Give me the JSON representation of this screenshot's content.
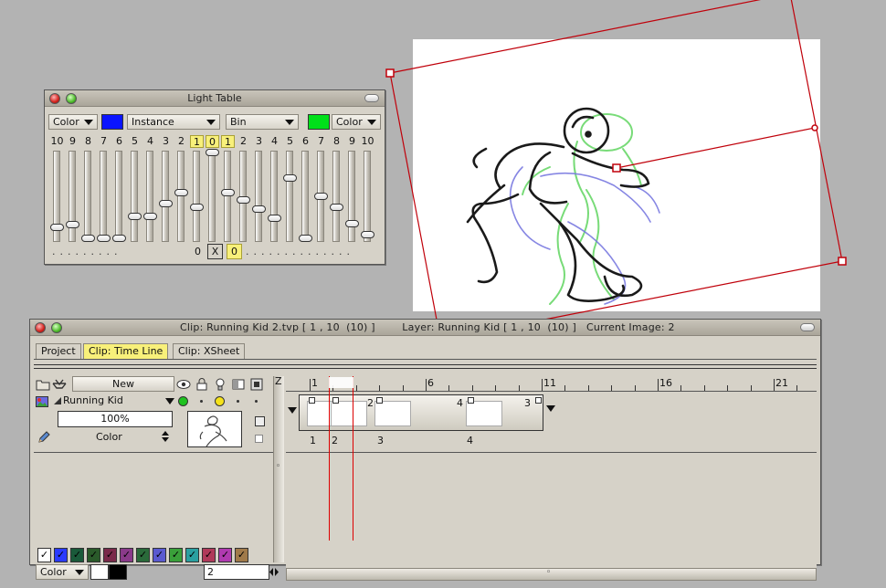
{
  "light_table": {
    "title": "Light Table",
    "left_mode": "Color",
    "left_color": "#0a14ff",
    "left_source": "Instance",
    "right_source": "Bin",
    "right_color": "#00e01a",
    "right_mode": "Color",
    "numbers": [
      "10",
      "9",
      "8",
      "7",
      "6",
      "5",
      "4",
      "3",
      "2",
      "1",
      "0",
      "1",
      "2",
      "3",
      "4",
      "5",
      "6",
      "7",
      "8",
      "9",
      "10"
    ],
    "bottom_zero": "0",
    "bottom_x": "X",
    "bottom_current": "0"
  },
  "clip_window": {
    "title": "Clip: Running Kid 2.tvp [ 1 , 10  (10) ]        Layer: Running Kid [ 1 , 10  (10) ]   Current Image: 2",
    "tabs": [
      "Project",
      "Clip: Time Line",
      "Clip: XSheet"
    ],
    "new_label": "New",
    "z_label": "Z",
    "layer": {
      "name": "Running Kid",
      "opacity": "100%",
      "blend": "Color"
    },
    "bottom_mode": "Color",
    "current_image": "2",
    "ruler": [
      "1",
      "6",
      "11",
      "16",
      "21"
    ],
    "strip_labels": [
      "2",
      "4",
      "3"
    ],
    "frame_labels": [
      "1",
      "2",
      "3",
      "4"
    ],
    "palette_colors": [
      "#ffffff",
      "#2a3bff",
      "#1a5a3a",
      "#2a5a2a",
      "#7a2a4a",
      "#8a3a8a",
      "#2a6a3a",
      "#5a5ad0",
      "#3aa03a",
      "#2aa0a0",
      "#b03a5a",
      "#b03ab0",
      "#a07a4a"
    ]
  }
}
